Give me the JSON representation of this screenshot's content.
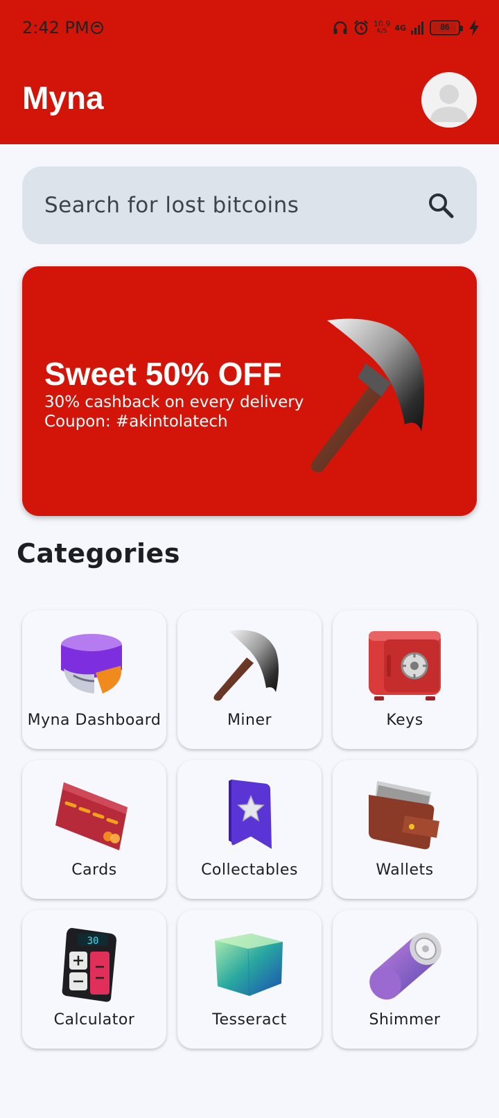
{
  "status_bar": {
    "time": "2:42 PM",
    "net_speed_value": "10.9",
    "net_speed_unit": "K/S",
    "network_type": "4G",
    "battery_level": "86"
  },
  "header": {
    "title": "Myna"
  },
  "search": {
    "placeholder": "Search for lost bitcoins"
  },
  "promo": {
    "title": "Sweet 50% OFF",
    "line1": "30% cashback on every delivery",
    "line2": "Coupon: #akintolatech"
  },
  "categories": {
    "title": "Categories",
    "items": [
      {
        "label": "Myna Dashboard",
        "icon": "dashboard-chart-icon"
      },
      {
        "label": "Miner",
        "icon": "pickaxe-icon"
      },
      {
        "label": "Keys",
        "icon": "safe-icon"
      },
      {
        "label": "Cards",
        "icon": "credit-card-icon"
      },
      {
        "label": "Collectables",
        "icon": "bookmark-star-icon"
      },
      {
        "label": "Wallets",
        "icon": "wallet-icon"
      },
      {
        "label": "Calculator",
        "icon": "calculator-icon"
      },
      {
        "label": "Tesseract",
        "icon": "cube-icon"
      },
      {
        "label": "Shimmer",
        "icon": "battery-cell-icon"
      }
    ]
  },
  "colors": {
    "brand_red": "#d21508",
    "background": "#f5f7fc",
    "search_bg": "#dde3ea"
  }
}
